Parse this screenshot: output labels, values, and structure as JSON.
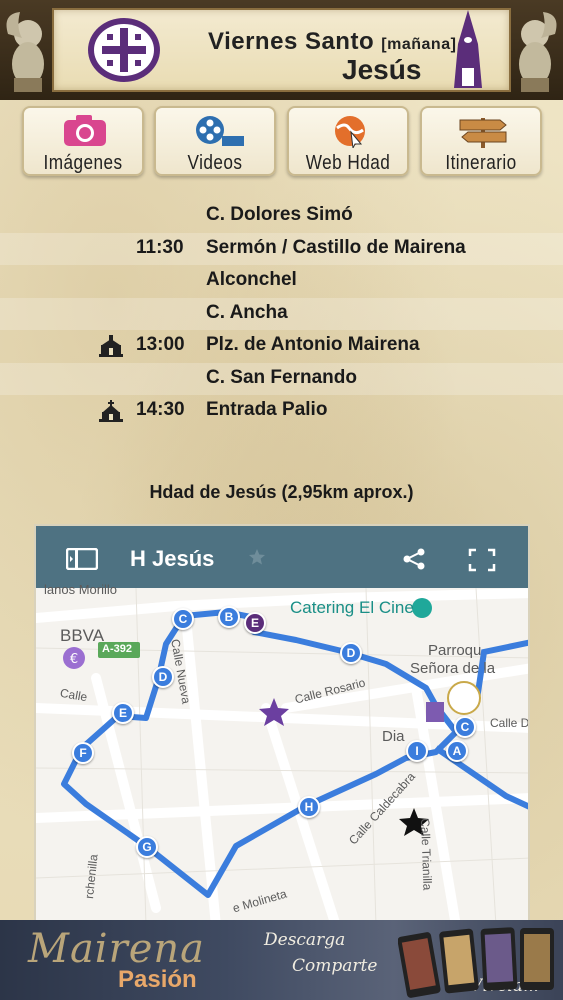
{
  "header": {
    "title_main": "Viernes Santo",
    "title_suffix": "[mañana]",
    "subtitle": "Jesús"
  },
  "nav": [
    {
      "label": "Imágenes",
      "icon": "camera-icon"
    },
    {
      "label": "Videos",
      "icon": "film-reel-icon"
    },
    {
      "label": "Web Hdad",
      "icon": "globe-cursor-icon"
    },
    {
      "label": "Itinerario",
      "icon": "signpost-icon"
    }
  ],
  "schedule": [
    {
      "time": "",
      "place": "C. Dolores Simó",
      "church": false
    },
    {
      "time": "11:30",
      "place": "Sermón / Castillo de Mairena",
      "church": false
    },
    {
      "time": "",
      "place": "Alconchel",
      "church": false
    },
    {
      "time": "",
      "place": "C. Ancha",
      "church": false
    },
    {
      "time": "13:00",
      "place": "Plz. de Antonio Mairena",
      "church": true
    },
    {
      "time": "",
      "place": "C. San Fernando",
      "church": false
    },
    {
      "time": "14:30",
      "place": "Entrada Palio",
      "church": true
    }
  ],
  "route_caption": "Hdad de Jesús (2,95km aprox.)",
  "map": {
    "title": "H Jesús",
    "labels": {
      "catering": "Catering El Cine",
      "bbva": "BBVA",
      "road": "A-392",
      "parroquia1": "Parroqu",
      "parroquia2": "Señora de la",
      "calle_nueva": "Calle Nueva",
      "calle_rosario": "Calle Rosario",
      "calle_caldecabra": "Calle Caldecabra",
      "calle_triani": "Calle Trianilla",
      "molineta": "e Molineta",
      "dia": "Dia",
      "calle_d": "Calle D",
      "calle_left": "Calle",
      "orchenilla": "rchenilla",
      "top_cut": "lanos Morillo"
    },
    "markers": [
      "A",
      "B",
      "C",
      "C",
      "D",
      "D",
      "E",
      "E",
      "F",
      "G",
      "H",
      "I"
    ]
  },
  "footer": {
    "brand_line1": "Mairena",
    "brand_line2": "Pasión",
    "slogan1": "Descarga",
    "slogan2": "Comparte",
    "slogan3": "Vívela..!"
  },
  "colors": {
    "route_blue": "#3b7ddd",
    "toolbar": "#4e7282",
    "purple": "#5b2d7a"
  }
}
